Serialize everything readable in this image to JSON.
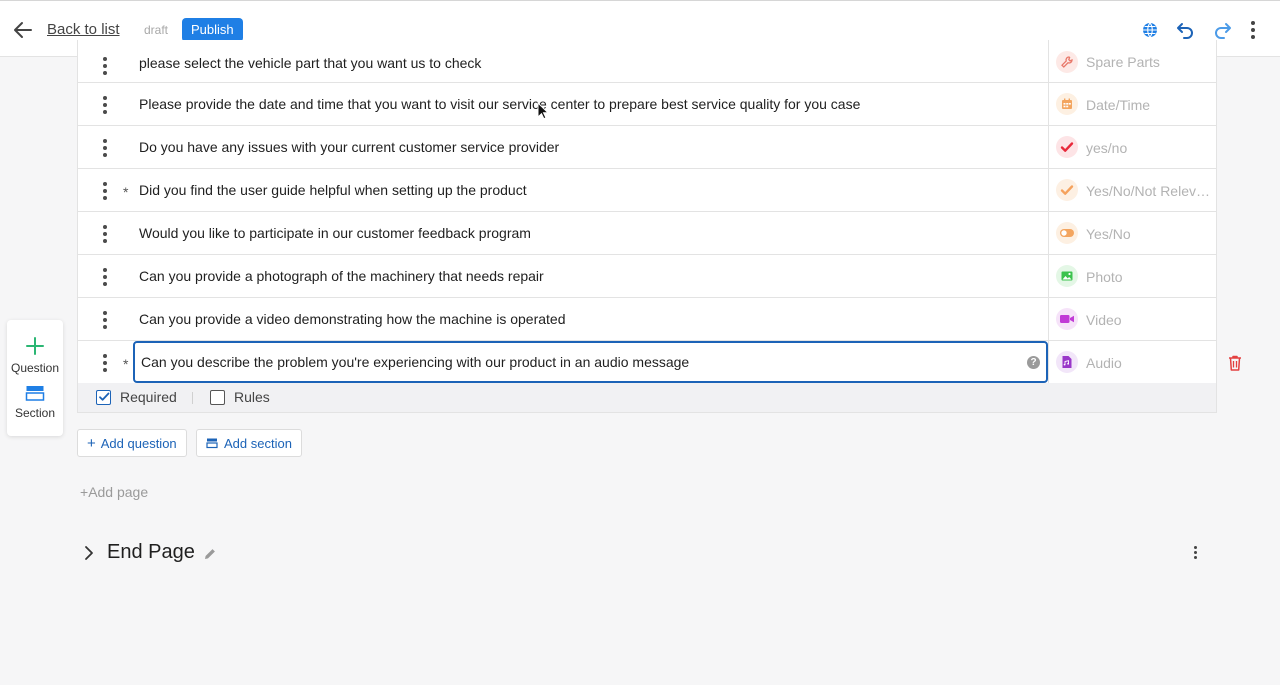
{
  "header": {
    "back_label": "Back to list",
    "status": "draft",
    "publish_label": "Publish",
    "icons": [
      "globe-icon",
      "undo-icon",
      "redo-icon",
      "more-vertical-icon"
    ],
    "colors": {
      "accent": "#1f7fe5",
      "primary": "#1c63b7"
    }
  },
  "questions": [
    {
      "text": "please select the vehicle part that you want us to check",
      "required": false,
      "type": "Spare Parts",
      "icon": "wrench-icon",
      "icon_color": "#e8786a",
      "icon_bg": "#fde9e6"
    },
    {
      "text": "Please provide the date and time that you want to visit our service center to prepare best service quality for you case",
      "required": false,
      "type": "Date/Time",
      "icon": "calendar-icon",
      "icon_color": "#f3a55f",
      "icon_bg": "#fdf0e2"
    },
    {
      "text": "Do you have any issues with your current customer service provider",
      "required": false,
      "type": "yes/no",
      "icon": "checkmark-icon",
      "icon_color": "#e8293b",
      "icon_bg": "#fde4e6"
    },
    {
      "text": "Did you find the user guide helpful when setting up the product",
      "required": true,
      "type": "Yes/No/Not Relev…",
      "icon": "checkmark-icon",
      "icon_color": "#f5a25d",
      "icon_bg": "#fdf0e3"
    },
    {
      "text": "Would you like to participate in our customer feedback program",
      "required": false,
      "type": "Yes/No",
      "icon": "toggle-icon",
      "icon_color": "#f3a55f",
      "icon_bg": "#fdf0e2"
    },
    {
      "text": "Can you provide a photograph of the machinery that needs repair",
      "required": false,
      "type": "Photo",
      "icon": "image-icon",
      "icon_color": "#3cc34e",
      "icon_bg": "#e4f7e6"
    },
    {
      "text": "Can you provide a video demonstrating how the machine is operated",
      "required": false,
      "type": "Video",
      "icon": "video-icon",
      "icon_color": "#c13ad6",
      "icon_bg": "#f6e3f9"
    },
    {
      "text": "Can you describe the problem you're experiencing with our product in an audio message",
      "required": true,
      "type": "Audio",
      "icon": "audio-file-icon",
      "icon_color": "#9a38c9",
      "icon_bg": "#f2e6f9"
    }
  ],
  "options": {
    "required_label": "Required",
    "required_checked": true,
    "rules_label": "Rules",
    "rules_checked": false
  },
  "panel": {
    "question_label": "Question",
    "section_label": "Section"
  },
  "actions": {
    "add_question": "Add question",
    "add_section": "Add section",
    "add_page": "Add page"
  },
  "end_page": {
    "title": "End Page"
  }
}
